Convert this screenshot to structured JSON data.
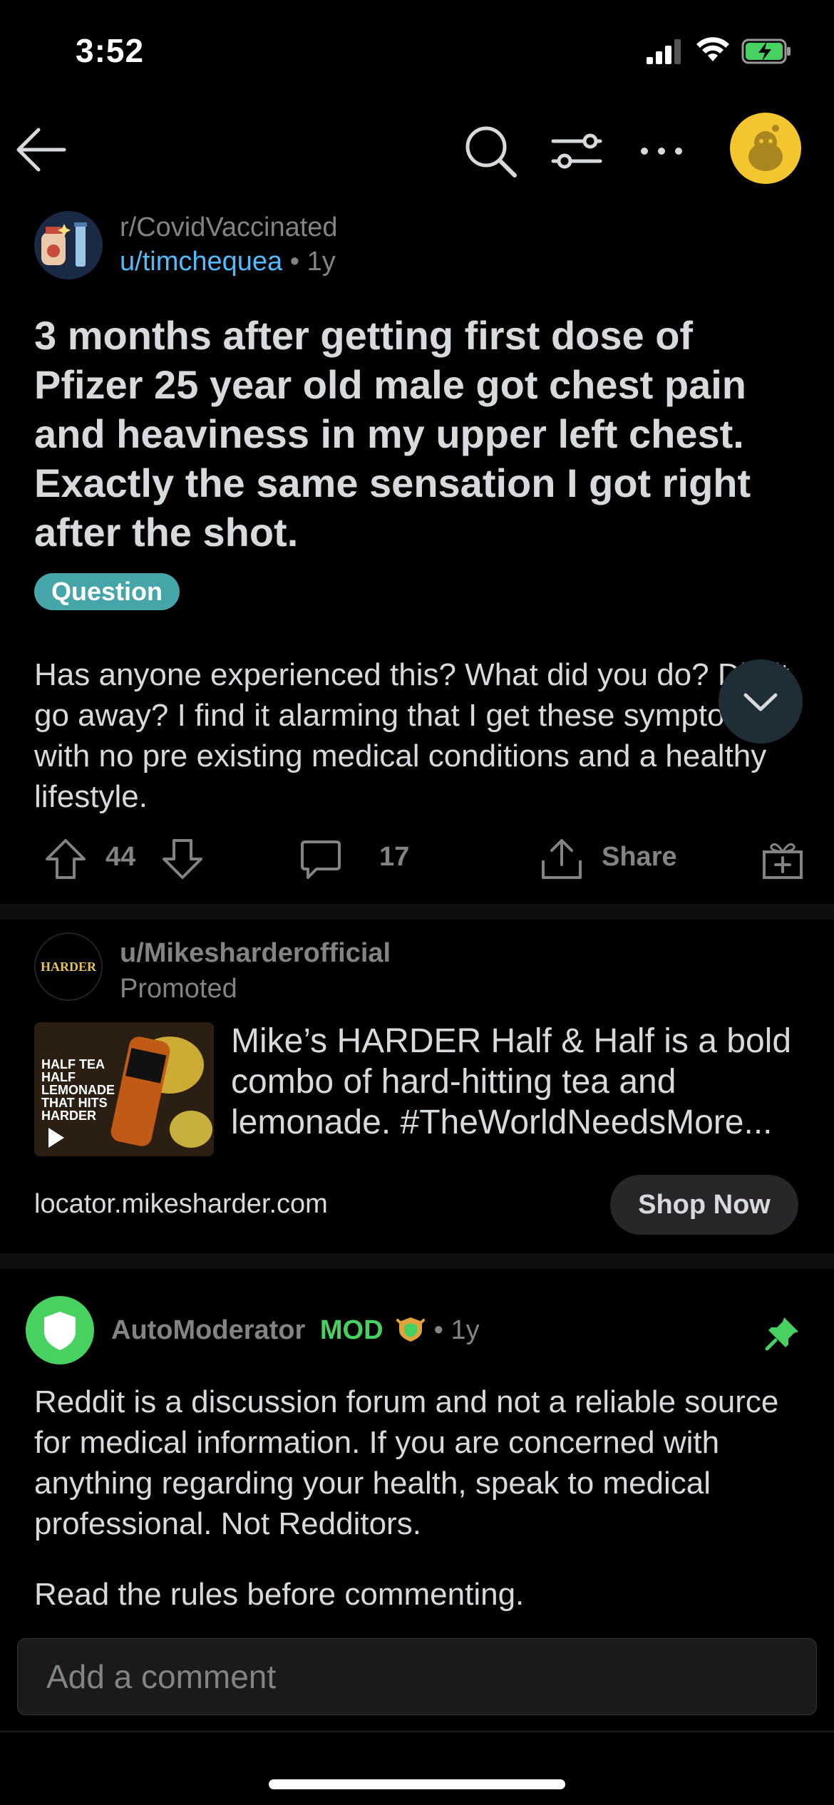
{
  "status_bar": {
    "time": "3:52"
  },
  "post": {
    "subreddit": "r/CovidVaccinated",
    "author": "u/timchequea",
    "age": "1y",
    "title": "3 months after getting first dose of Pfizer 25 year old male got chest pain and heaviness in my upper left chest. Exactly the same sensation I got right after the shot.",
    "flair": "Question",
    "body": "Has anyone experienced this? What did you do? Did it go away? I find it alarming that I get these symptoms with no pre existing medical conditions and a healthy lifestyle.",
    "upvotes": "44",
    "comments": "17",
    "share_label": "Share"
  },
  "promoted": {
    "user": "u/Mikesharderofficial",
    "label": "Promoted",
    "text": "Mike’s HARDER Half & Half is a bold combo of hard-hitting tea and lemonade. #TheWorldNeedsMore...",
    "thumbnail_caption": "HALF TEA HALF LEMONADE THAT HITS HARDER",
    "logo_text": "HARDER",
    "domain": "locator.mikesharder.com",
    "cta": "Shop Now"
  },
  "comment": {
    "author": "AutoModerator",
    "badge": "MOD",
    "age": "1y",
    "body": "Reddit is a discussion forum and not a reliable source for medical information. If you are concerned with anything regarding your health, speak to medical professional. Not Redditors.",
    "body_2": "Read the rules before commenting."
  },
  "composer": {
    "placeholder": "Add a comment"
  },
  "colors": {
    "background": "#000000",
    "link_blue": "#4fbcff",
    "flair_teal": "#46a5a8",
    "mod_green": "#46d160",
    "snoo_yellow": "#f3c52e"
  },
  "icons": [
    "back-arrow-icon",
    "search-icon",
    "filter-icon",
    "more-icon",
    "upvote-icon",
    "downvote-icon",
    "comment-icon",
    "share-icon",
    "award-icon",
    "pin-icon",
    "chevron-down-icon"
  ]
}
